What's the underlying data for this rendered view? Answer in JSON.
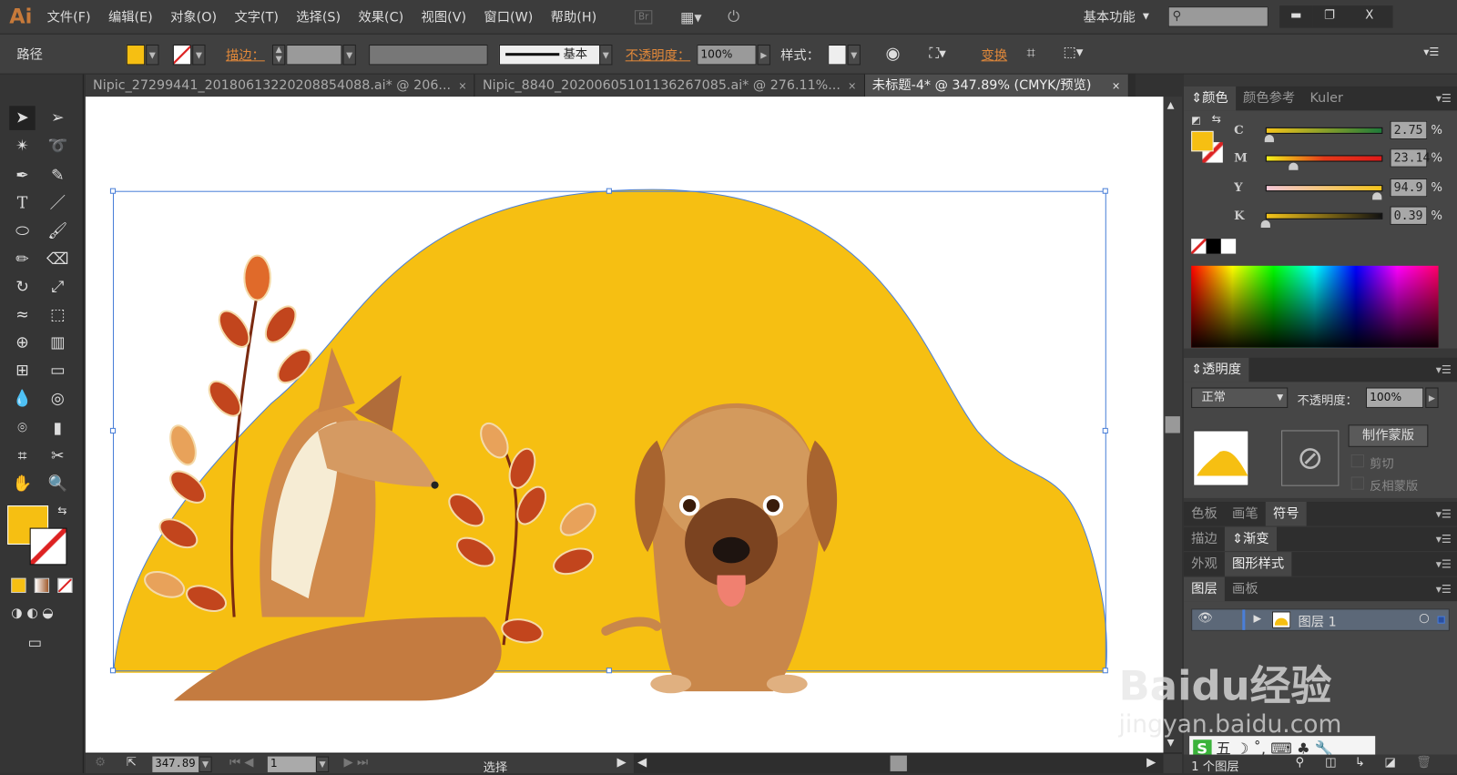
{
  "app": {
    "logo": "Ai",
    "menus": [
      "文件(F)",
      "编辑(E)",
      "对象(O)",
      "文字(T)",
      "选择(S)",
      "效果(C)",
      "视图(V)",
      "窗口(W)",
      "帮助(H)"
    ],
    "bridge": "Br",
    "workspace": "基本功能",
    "search_placeholder": ""
  },
  "control": {
    "selection": "路径",
    "stroke_label": "描边：",
    "brush": "基本",
    "opacity_label": "不透明度：",
    "opacity": "100%",
    "style_label": "样式：",
    "transform": "变换"
  },
  "colors": {
    "fill": "#f6bf12",
    "canvas_shape": "#f6bf12"
  },
  "tabs": [
    {
      "label": "Nipic_27299441_20180613220208854088.ai* @ 206...",
      "active": false
    },
    {
      "label": "Nipic_8840_20200605101136267085.ai* @ 276.11%...",
      "active": false
    },
    {
      "label": "未标题-4* @ 347.89% (CMYK/预览)",
      "active": true
    }
  ],
  "color_panel": {
    "tabs": [
      "颜色",
      "颜色参考",
      "Kuler"
    ],
    "channels": [
      {
        "name": "C",
        "value": "2.75",
        "pct": 2.75
      },
      {
        "name": "M",
        "value": "23.14",
        "pct": 23.14
      },
      {
        "name": "Y",
        "value": "94.9",
        "pct": 94.9
      },
      {
        "name": "K",
        "value": "0.39",
        "pct": 0.39
      }
    ],
    "unit": "%"
  },
  "transparency": {
    "title": "透明度",
    "mode": "正常",
    "opacity_label": "不透明度：",
    "opacity": "100%",
    "make_mask": "制作蒙版",
    "clip": "剪切",
    "invert": "反相蒙版"
  },
  "panel_groups": [
    [
      "色板",
      "画笔",
      "符号"
    ],
    [
      "描边",
      "渐变"
    ],
    [
      "外观",
      "图形样式"
    ],
    [
      "图层",
      "画板"
    ]
  ],
  "layers": {
    "items": [
      {
        "name": "图层 1"
      }
    ],
    "count": "1 个图层"
  },
  "status": {
    "zoom": "347.89",
    "artboard": "1",
    "tool": "选择"
  },
  "watermark": {
    "brand": "Baidu经验",
    "url": "jingyan.baidu.com"
  },
  "ime": {
    "label": "五"
  }
}
